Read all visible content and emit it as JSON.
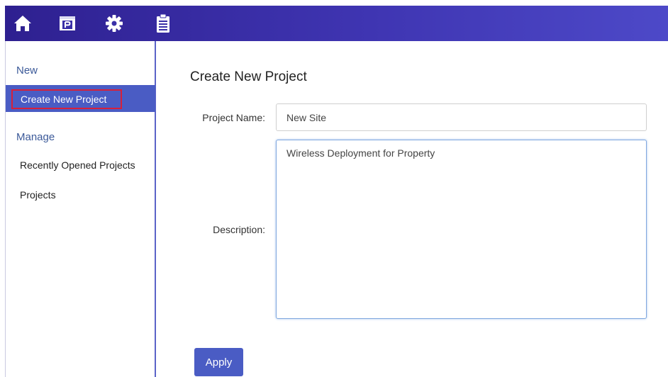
{
  "toolbar": {
    "icons": [
      "home-icon",
      "project-icon",
      "gear-icon",
      "clipboard-icon"
    ],
    "background_color": "#3a30a8"
  },
  "sidebar": {
    "new_heading": "New",
    "create_item": "Create New Project",
    "manage_heading": "Manage",
    "recent_item": "Recently Opened Projects",
    "projects_item": "Projects",
    "active_color": "#4a5cc4",
    "highlight_border_color": "#d6203a"
  },
  "form": {
    "title": "Create New Project",
    "project_name_label": "Project Name:",
    "project_name_value": "New Site",
    "description_label": "Description:",
    "description_value": "Wireless Deployment for Property",
    "apply_label": "Apply"
  }
}
